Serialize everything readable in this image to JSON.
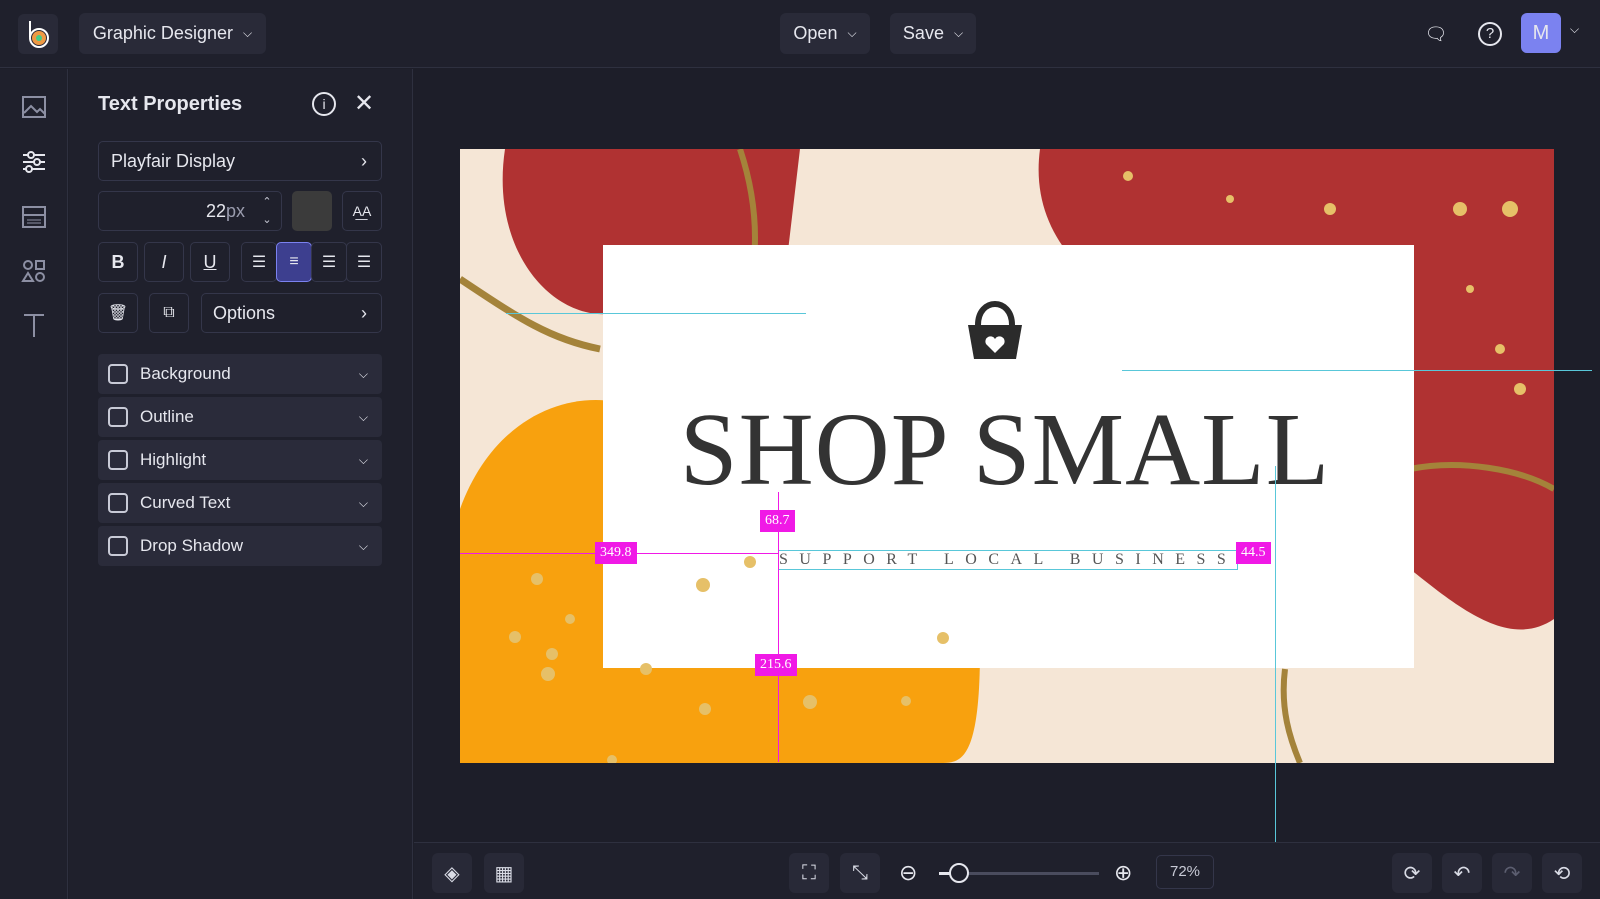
{
  "header": {
    "workspace": "Graphic Designer",
    "open": "Open",
    "save": "Save",
    "avatar": "M"
  },
  "panel": {
    "title": "Text Properties",
    "font": "Playfair Display",
    "size": "22",
    "unit": "px",
    "options": "Options",
    "sections": [
      {
        "label": "Background"
      },
      {
        "label": "Outline"
      },
      {
        "label": "Highlight"
      },
      {
        "label": "Curved Text"
      },
      {
        "label": "Drop Shadow"
      }
    ]
  },
  "canvas": {
    "title": "SHOP SMALL",
    "subtitle": "SUPPORT LOCAL BUSINESS",
    "measures": {
      "top": "68.7",
      "left": "349.8",
      "right": "44.5",
      "bottom": "215.6"
    }
  },
  "footer": {
    "zoom": "72%",
    "zoom_fraction": 0.1
  },
  "colors": {
    "accent": "#3d3f8f",
    "guide": "#f019e6",
    "snap": "#59c7d9"
  }
}
